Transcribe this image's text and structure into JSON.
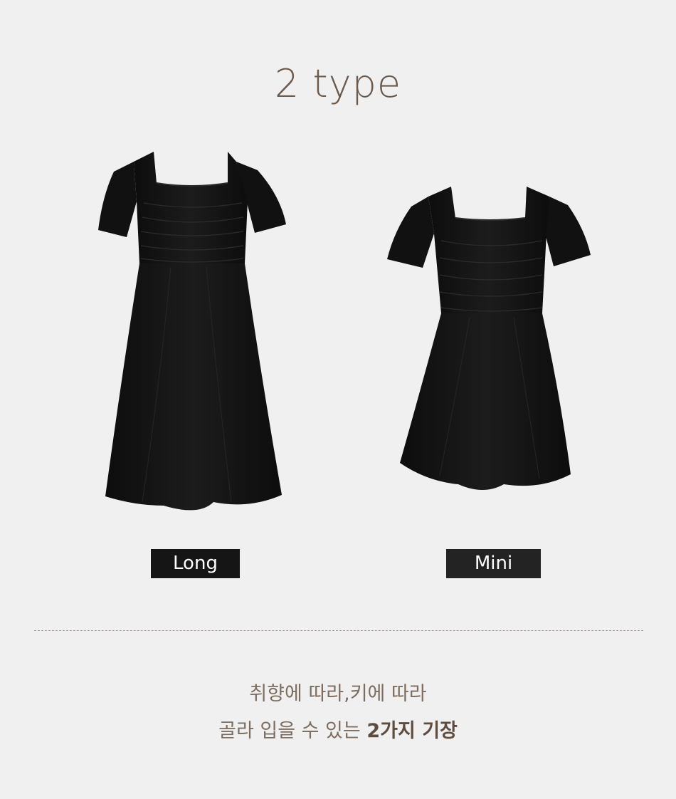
{
  "header": {
    "title": "2 type"
  },
  "types": [
    {
      "label": "Long"
    },
    {
      "label": "Mini"
    }
  ],
  "caption": {
    "line1": "취향에 따라,키에 따라",
    "line2_regular": "골라 입을 수 있는 ",
    "line2_bold": "2가지 기장"
  }
}
